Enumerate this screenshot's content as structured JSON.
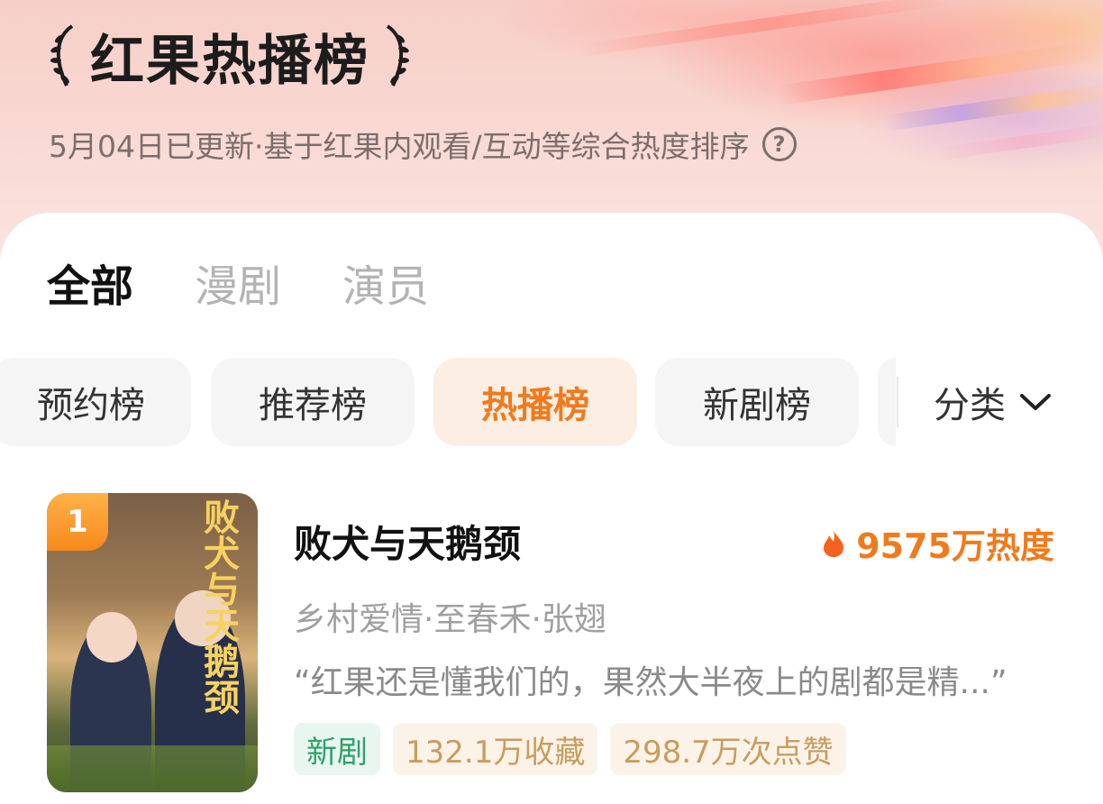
{
  "header": {
    "title": "红果热播榜",
    "subtitle": "5月04日已更新·基于红果内观看/互动等综合热度排序",
    "help_icon": "question-circle-icon"
  },
  "tabs": [
    {
      "label": "全部",
      "active": true
    },
    {
      "label": "漫剧",
      "active": false
    },
    {
      "label": "演员",
      "active": false
    }
  ],
  "rank_chips": [
    {
      "label": "预约榜",
      "active": false
    },
    {
      "label": "推荐榜",
      "active": false
    },
    {
      "label": "热播榜",
      "active": true
    },
    {
      "label": "新剧榜",
      "active": false
    }
  ],
  "category": {
    "label": "分类",
    "icon": "chevron-down-icon"
  },
  "list": [
    {
      "rank": "1",
      "title": "败犬与天鹅颈",
      "heat": "9575万热度",
      "meta": "乡村爱情·至春禾·张翅",
      "quote": "“红果还是懂我们的，果然大半夜上的剧都是精...”",
      "tags": [
        {
          "label": "新剧",
          "kind": "new"
        },
        {
          "label": "132.1万收藏",
          "kind": "stat"
        },
        {
          "label": "298.7万次点赞",
          "kind": "stat"
        }
      ],
      "poster_calligraphy": "败犬与天鹅颈"
    }
  ],
  "colors": {
    "accent": "#f07a1c",
    "new_tag": "#2fa06a",
    "stat_tag": "#c99c5e"
  }
}
